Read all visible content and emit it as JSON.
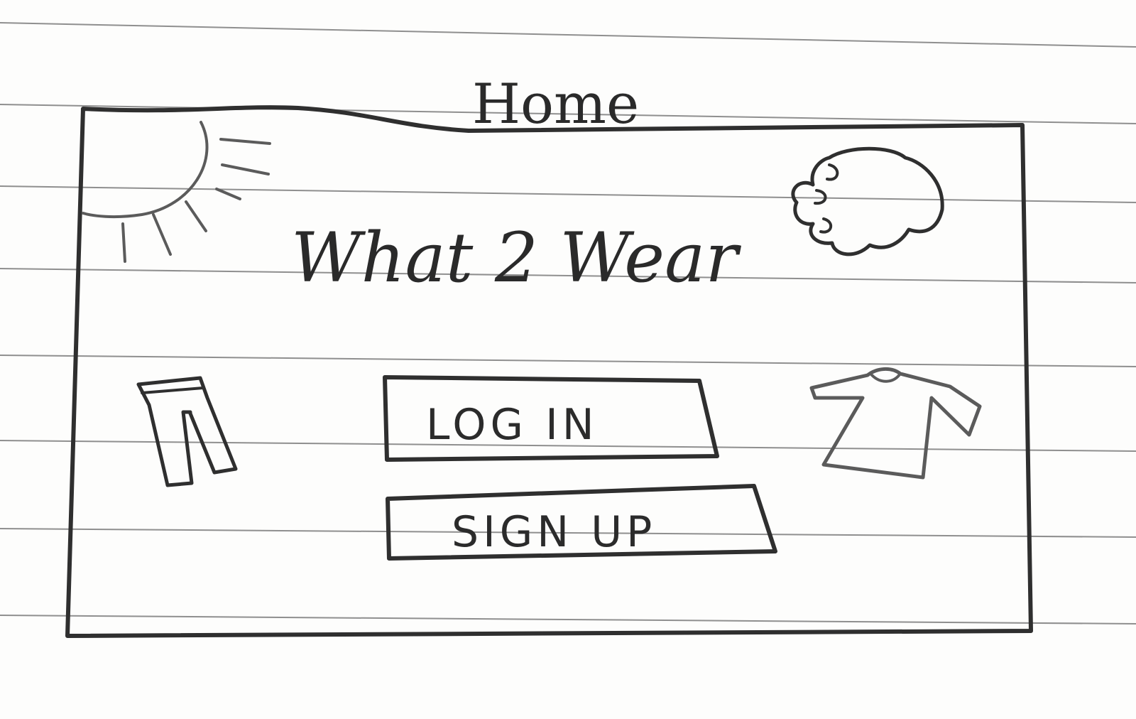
{
  "page": {
    "title": "Home"
  },
  "screen": {
    "app_title": "What 2 Wear",
    "buttons": {
      "login_label": "LOG IN",
      "signup_label": "SIGN UP"
    },
    "decorations": {
      "sun": "sun-icon",
      "cloud": "cloud-icon",
      "pants": "pants-icon",
      "shirt": "shirt-icon"
    }
  },
  "colors": {
    "paper": "#fdfdfc",
    "ink": "#2f2f2f",
    "ruled_line": "#8f8f8f"
  }
}
